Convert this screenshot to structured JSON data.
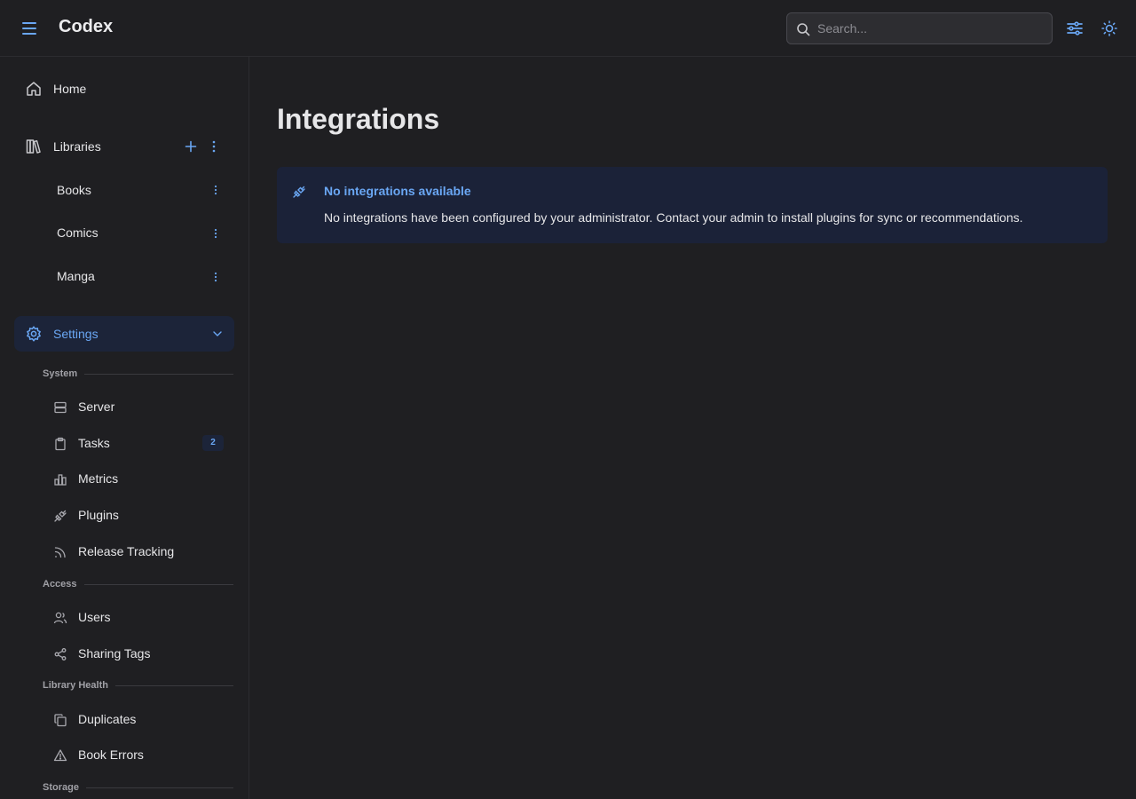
{
  "header": {
    "app_title": "Codex",
    "search": {
      "placeholder": "Search...",
      "value": ""
    },
    "icons": [
      "menu-icon",
      "search-icon",
      "filter-sliders-icon",
      "theme-sun-icon"
    ]
  },
  "sidebar": {
    "home_label": "Home",
    "libraries": {
      "label": "Libraries",
      "items": [
        {
          "label": "Books"
        },
        {
          "label": "Comics"
        },
        {
          "label": "Manga"
        }
      ]
    },
    "settings_label": "Settings",
    "sections": {
      "system": {
        "title": "System",
        "items": [
          {
            "label": "Server",
            "icon": "server-icon"
          },
          {
            "label": "Tasks",
            "icon": "clipboard-icon",
            "badge": "2"
          },
          {
            "label": "Metrics",
            "icon": "bar-chart-icon"
          },
          {
            "label": "Plugins",
            "icon": "plug-icon"
          },
          {
            "label": "Release Tracking",
            "icon": "rss-icon"
          }
        ]
      },
      "access": {
        "title": "Access",
        "items": [
          {
            "label": "Users",
            "icon": "users-icon"
          },
          {
            "label": "Sharing Tags",
            "icon": "share-icon"
          }
        ]
      },
      "library_health": {
        "title": "Library Health",
        "items": [
          {
            "label": "Duplicates",
            "icon": "copy-icon"
          },
          {
            "label": "Book Errors",
            "icon": "warning-icon"
          }
        ]
      },
      "storage": {
        "title": "Storage"
      }
    }
  },
  "main": {
    "title": "Integrations",
    "alert": {
      "title": "No integrations available",
      "message": "No integrations have been configured by your administrator. Contact your admin to install plugins for sync or recommendations."
    }
  },
  "colors": {
    "accent": "#6aa7f4",
    "background": "#1f1f22",
    "active_bg": "#1c2439",
    "alert_bg": "#1b2238"
  }
}
